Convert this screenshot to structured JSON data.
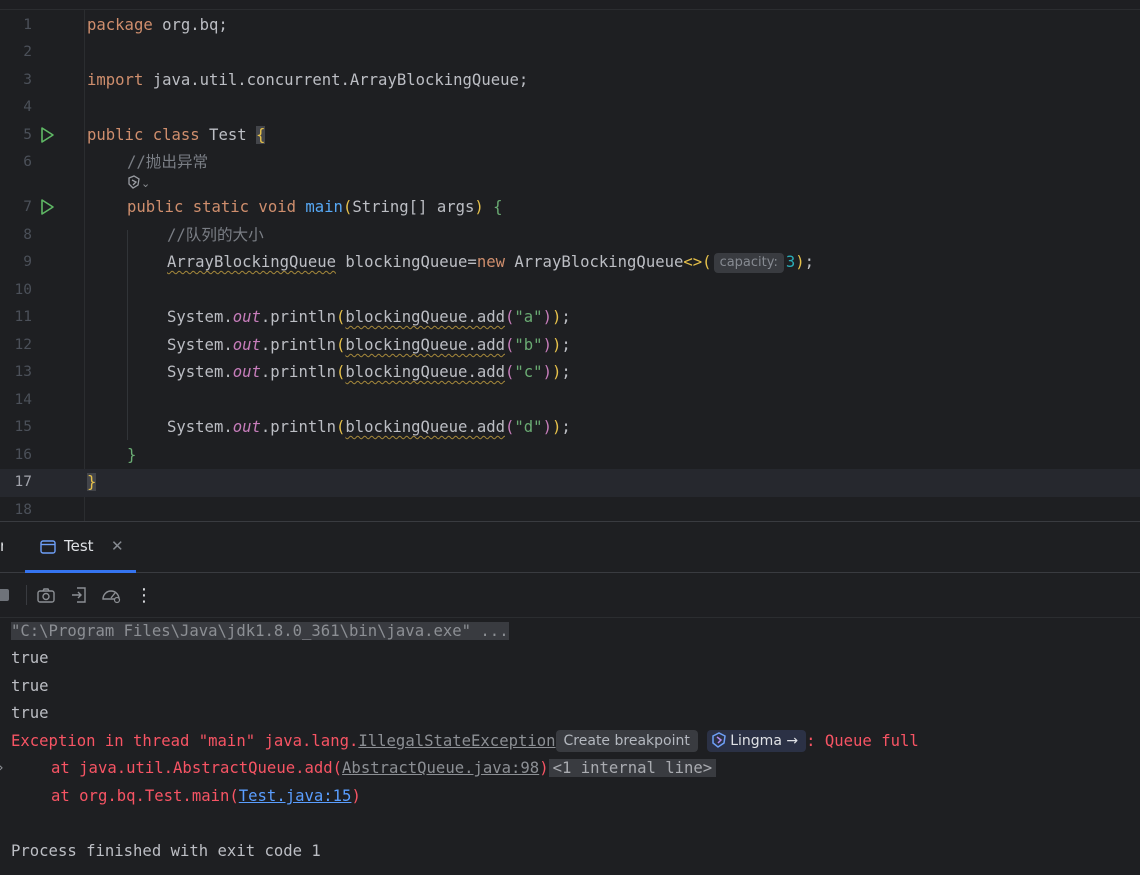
{
  "editor": {
    "line_numbers": [
      "1",
      "2",
      "3",
      "4",
      "5",
      "6",
      "7",
      "8",
      "9",
      "10",
      "11",
      "12",
      "13",
      "14",
      "15",
      "16",
      "17",
      "18"
    ],
    "current_line": "17",
    "lines": {
      "l1": {
        "kw": "package",
        "rest": " org.bq;"
      },
      "l3": {
        "kw": "import",
        "rest": " java.util.concurrent.ArrayBlockingQueue;"
      },
      "l5": {
        "kw": "public class",
        "name": " Test ",
        "brace": "{"
      },
      "l6": {
        "comment": "//抛出异常"
      },
      "l7": {
        "kw": "public static void ",
        "fn": "main",
        "open": "(",
        "params": "String[] args",
        "close": ")",
        "brace": " {"
      },
      "l8": {
        "comment": "//队列的大小"
      },
      "l9": {
        "type": "ArrayBlockingQueue",
        "mid": " blockingQueue=",
        "kw": "new",
        "ctor": " ArrayBlockingQueue",
        "diamond": "<>",
        "open": "(",
        "hint": "capacity:",
        "num": "3",
        "close": ")",
        "end": ";"
      },
      "l11": {
        "sys": "System.",
        "out": "out",
        "println": ".println",
        "open": "(",
        "expr": "blockingQueue.add",
        "arg_open": "(",
        "arg": "\"a\"",
        "arg_close": ")",
        "close": ")",
        "end": ";"
      },
      "l12": {
        "sys": "System.",
        "out": "out",
        "println": ".println",
        "open": "(",
        "expr": "blockingQueue.add",
        "arg_open": "(",
        "arg": "\"b\"",
        "arg_close": ")",
        "close": ")",
        "end": ";"
      },
      "l13": {
        "sys": "System.",
        "out": "out",
        "println": ".println",
        "open": "(",
        "expr": "blockingQueue.add",
        "arg_open": "(",
        "arg": "\"c\"",
        "arg_close": ")",
        "close": ")",
        "end": ";"
      },
      "l15": {
        "sys": "System.",
        "out": "out",
        "println": ".println",
        "open": "(",
        "expr": "blockingQueue.add",
        "arg_open": "(",
        "arg": "\"d\"",
        "arg_close": ")",
        "close": ")",
        "end": ";"
      },
      "l16": {
        "brace": "}"
      },
      "l17": {
        "brace": "}"
      }
    },
    "ai_hint_icon": "lingma-icon",
    "ai_hint_chevron": "⌄"
  },
  "run_panel": {
    "tab_label": "Test",
    "tab_close": "✕",
    "tab_icon": "console-icon",
    "toolbar": [
      "stop-icon",
      "camera-icon",
      "exit-icon",
      "gauge-icon",
      "more-vert-icon"
    ],
    "more_label": "⋮"
  },
  "console": {
    "cmd": "\"C:\\Program Files\\Java\\jdk1.8.0_361\\bin\\java.exe\" ...",
    "out1": "true",
    "out2": "true",
    "out3": "true",
    "exc_prefix": "Exception in thread \"main\" java.lang.",
    "exc_class": "IllegalStateException",
    "create_breakpoint": "Create breakpoint",
    "lingma": "Lingma",
    "lingma_arrow": "→",
    "exc_suffix": ": Queue full",
    "trace1_prefix": "at java.util.AbstractQueue.add(",
    "trace1_link": "AbstractQueue.java:98",
    "trace1_close": ")",
    "trace1_collapsed": "<1 internal line>",
    "trace2_prefix": "at org.bq.Test.main(",
    "trace2_link": "Test.java:15",
    "trace2_close": ")",
    "finished": "Process finished with exit code 1",
    "expand_arrow": "›"
  },
  "colors": {
    "accent": "#3574f0",
    "error": "#f75464",
    "link": "#5a9eff",
    "run_green": "#5fb865"
  }
}
